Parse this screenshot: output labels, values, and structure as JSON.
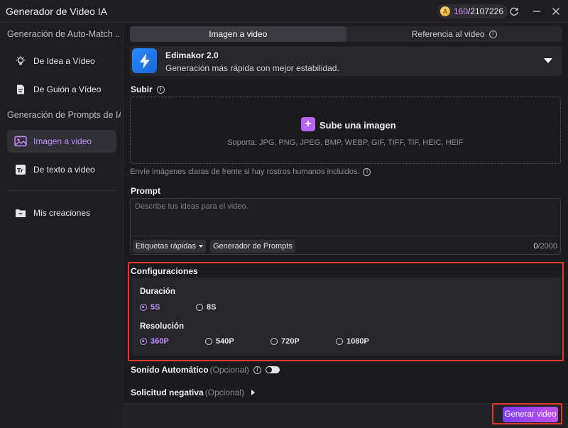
{
  "window": {
    "title": "Generador de Video IA"
  },
  "credits": {
    "used": "160",
    "total": "/2107226"
  },
  "sidebar": {
    "section1": "Generación de Auto-Match ...",
    "section2": "Generación de Prompts de IA",
    "items": [
      {
        "label": "De Idea a Vídeo",
        "icon": "lightbulb-icon"
      },
      {
        "label": "De Guión a Vídeo",
        "icon": "script-icon"
      },
      {
        "label": "Imagen a video",
        "icon": "image-icon",
        "active": true
      },
      {
        "label": "De texto a video",
        "icon": "text-icon"
      },
      {
        "label": "Mis creaciones",
        "icon": "folder-icon"
      }
    ]
  },
  "tabs": [
    {
      "label": "Imagen a video",
      "active": true
    },
    {
      "label": "Referencia al video",
      "active": false
    }
  ],
  "model": {
    "name": "Edimakor 2.0",
    "description": "Generación más rápida con mejor estabilidad."
  },
  "upload": {
    "section_label": "Subir",
    "title": "Sube una imagen",
    "formats": "Soporta: JPG, PNG, JPEG, BMP, WEBP, GIF, TIFF, TIF, HEIC, HEIF",
    "hint": "Envíe imágenes claras de frente si hay rostros humanos incluidos."
  },
  "prompt": {
    "section_label": "Prompt",
    "placeholder": "Describe tus ideas para el video.",
    "quick_tags": "Etiquetas rápidas",
    "generator": "Generador de Prompts",
    "count": "0",
    "max": "/2000"
  },
  "config": {
    "title": "Configuraciones",
    "duration_label": "Duración",
    "durations": [
      {
        "label": "5S",
        "selected": true
      },
      {
        "label": "8S",
        "selected": false
      }
    ],
    "resolution_label": "Resolución",
    "resolutions": [
      {
        "label": "360P",
        "selected": true
      },
      {
        "label": "540P",
        "selected": false
      },
      {
        "label": "720P",
        "selected": false
      },
      {
        "label": "1080P",
        "selected": false
      }
    ]
  },
  "auto_sound": {
    "label": "Sonido Automático",
    "optional": "(Opcional)",
    "enabled": false
  },
  "negative": {
    "label": "Solicitud negativa",
    "optional": "(Opcional)"
  },
  "generate_button": "Generar video",
  "colors": {
    "accent": "#c48cff",
    "highlight": "#e0392b",
    "background": "#1b1b1f"
  }
}
